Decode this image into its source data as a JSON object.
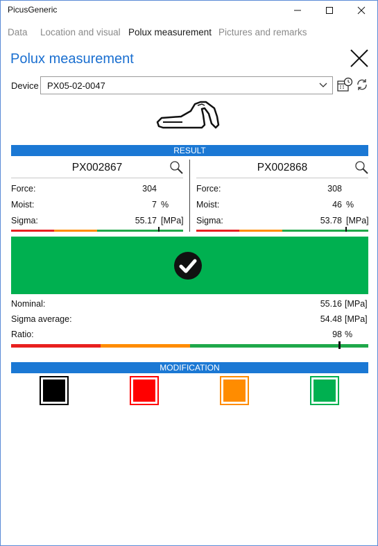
{
  "app": {
    "title": "PicusGeneric"
  },
  "window_controls": {
    "minimize": "minimize",
    "maximize": "maximize",
    "close": "close"
  },
  "tabs": [
    {
      "label": "Data",
      "active": false
    },
    {
      "label": "Location and visual",
      "active": false
    },
    {
      "label": "Polux measurement",
      "active": true
    },
    {
      "label": "Pictures and remarks",
      "active": false
    }
  ],
  "header": {
    "title": "Polux measurement"
  },
  "device": {
    "label": "Device",
    "value": "PX05-02-0047"
  },
  "result": {
    "title": "RESULT",
    "measurements": [
      {
        "code": "PX002867",
        "force_label": "Force:",
        "force": "304",
        "moist_label": "Moist:",
        "moist": "7",
        "moist_unit": "%",
        "sigma_label": "Sigma:",
        "sigma": "55.17",
        "sigma_unit": "[MPa]",
        "sigma_position": 0.86
      },
      {
        "code": "PX002868",
        "force_label": "Force:",
        "force": "308",
        "moist_label": "Moist:",
        "moist": "46",
        "moist_unit": "%",
        "sigma_label": "Sigma:",
        "sigma": "53.78",
        "sigma_unit": "[MPa]",
        "sigma_position": 0.87
      }
    ],
    "status": "ok",
    "status_color": "#00b050",
    "nominal_label": "Nominal:",
    "nominal": "55.16",
    "nominal_unit": "[MPa]",
    "sigma_avg_label": "Sigma average:",
    "sigma_avg": "54.48",
    "sigma_avg_unit": "[MPa]",
    "ratio_label": "Ratio:",
    "ratio": "98",
    "ratio_unit": "%",
    "ratio_position": 0.98
  },
  "modification": {
    "title": "MODIFICATION",
    "options": [
      {
        "name": "black",
        "color": "#000000"
      },
      {
        "name": "red",
        "color": "#ff0000"
      },
      {
        "name": "orange",
        "color": "#ff8c00"
      },
      {
        "name": "green",
        "color": "#00b050"
      }
    ]
  },
  "colors": {
    "accent": "#1b78d4",
    "red": "#e8201f",
    "orange": "#ff8c00",
    "green": "#1fa84a"
  },
  "icons": {
    "device_calendar": "calendar-clock-icon",
    "device_sync": "sync-icon",
    "device_image": "polux-device-icon",
    "search": "magnifier-icon",
    "status": "check-circle-icon"
  }
}
